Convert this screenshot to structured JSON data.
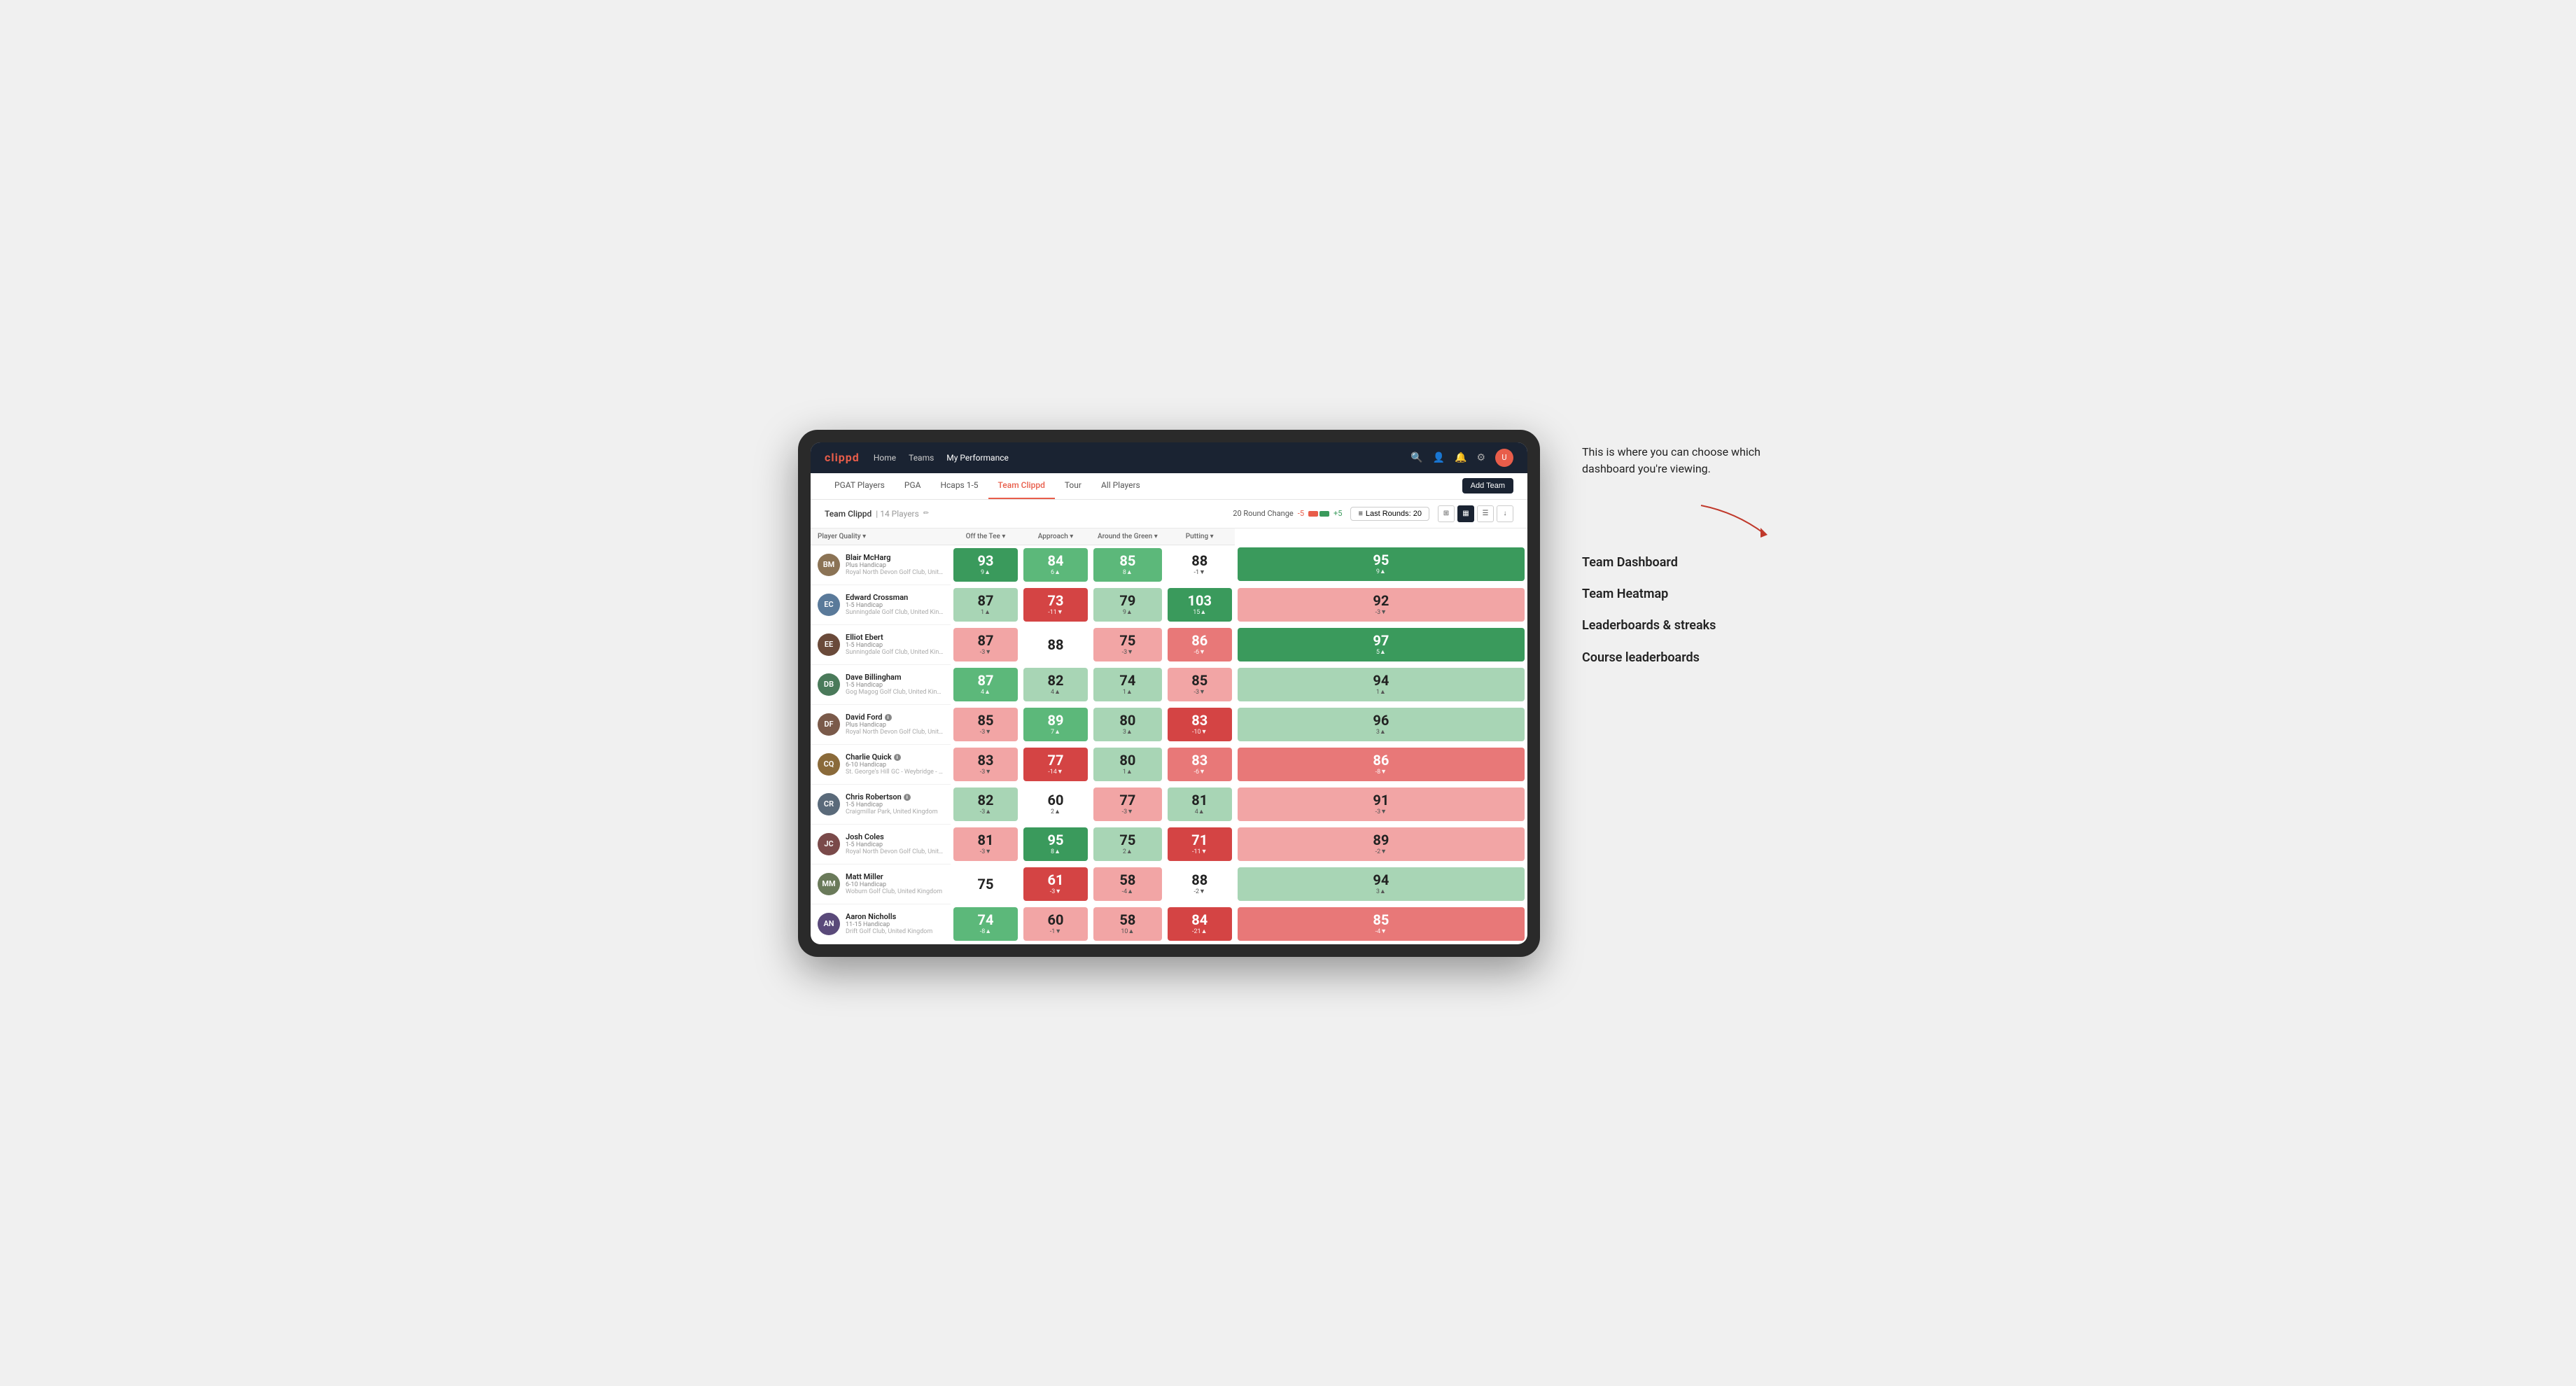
{
  "annotation": {
    "text": "This is where you can choose which dashboard you're viewing.",
    "menu_options": [
      "Team Dashboard",
      "Team Heatmap",
      "Leaderboards & streaks",
      "Course leaderboards"
    ]
  },
  "nav": {
    "logo": "clippd",
    "links": [
      {
        "label": "Home",
        "active": false
      },
      {
        "label": "Teams",
        "active": false
      },
      {
        "label": "My Performance",
        "active": true
      }
    ],
    "icons": [
      "search",
      "user",
      "bell",
      "settings",
      "avatar"
    ]
  },
  "sub_nav": {
    "links": [
      {
        "label": "PGAT Players",
        "active": false
      },
      {
        "label": "PGA",
        "active": false
      },
      {
        "label": "Hcaps 1-5",
        "active": false
      },
      {
        "label": "Team Clippd",
        "active": true
      },
      {
        "label": "Tour",
        "active": false
      },
      {
        "label": "All Players",
        "active": false
      }
    ],
    "add_team_label": "Add Team"
  },
  "team_header": {
    "title": "Team Clippd",
    "player_count": "14 Players",
    "round_change_label": "20 Round Change",
    "round_change_neg": "-5",
    "round_change_pos": "+5",
    "last_rounds_label": "Last Rounds: 20"
  },
  "columns": {
    "player_quality": "Player Quality ▾",
    "off_tee": "Off the Tee ▾",
    "approach": "Approach ▾",
    "around_green": "Around the Green ▾",
    "putting": "Putting ▾"
  },
  "players": [
    {
      "name": "Blair McHarg",
      "handicap": "Plus Handicap",
      "club": "Royal North Devon Golf Club, United Kingdom",
      "initials": "BM",
      "avatar_color": "#8B7355",
      "scores": [
        {
          "value": "93",
          "change": "9▲",
          "bg": "bg-green-dark",
          "light": true
        },
        {
          "value": "84",
          "change": "6▲",
          "bg": "bg-green-mid",
          "light": true
        },
        {
          "value": "85",
          "change": "8▲",
          "bg": "bg-green-mid",
          "light": true
        },
        {
          "value": "88",
          "change": "-1▼",
          "bg": "bg-white",
          "light": false
        },
        {
          "value": "95",
          "change": "9▲",
          "bg": "bg-green-dark",
          "light": true
        }
      ]
    },
    {
      "name": "Edward Crossman",
      "handicap": "1-5 Handicap",
      "club": "Sunningdale Golf Club, United Kingdom",
      "initials": "EC",
      "avatar_color": "#5a7a9a",
      "scores": [
        {
          "value": "87",
          "change": "1▲",
          "bg": "bg-green-light",
          "light": false
        },
        {
          "value": "73",
          "change": "-11▼",
          "bg": "bg-red-dark",
          "light": true
        },
        {
          "value": "79",
          "change": "9▲",
          "bg": "bg-green-light",
          "light": false
        },
        {
          "value": "103",
          "change": "15▲",
          "bg": "bg-green-dark",
          "light": true
        },
        {
          "value": "92",
          "change": "-3▼",
          "bg": "bg-red-light",
          "light": false
        }
      ]
    },
    {
      "name": "Elliot Ebert",
      "handicap": "1-5 Handicap",
      "club": "Sunningdale Golf Club, United Kingdom",
      "initials": "EE",
      "avatar_color": "#6a4a3a",
      "scores": [
        {
          "value": "87",
          "change": "-3▼",
          "bg": "bg-red-light",
          "light": false
        },
        {
          "value": "88",
          "change": "",
          "bg": "bg-white",
          "light": false
        },
        {
          "value": "75",
          "change": "-3▼",
          "bg": "bg-red-light",
          "light": false
        },
        {
          "value": "86",
          "change": "-6▼",
          "bg": "bg-red-mid",
          "light": true
        },
        {
          "value": "97",
          "change": "5▲",
          "bg": "bg-green-dark",
          "light": true
        }
      ]
    },
    {
      "name": "Dave Billingham",
      "handicap": "1-5 Handicap",
      "club": "Gog Magog Golf Club, United Kingdom",
      "initials": "DB",
      "avatar_color": "#4a7a5a",
      "scores": [
        {
          "value": "87",
          "change": "4▲",
          "bg": "bg-green-mid",
          "light": true
        },
        {
          "value": "82",
          "change": "4▲",
          "bg": "bg-green-light",
          "light": false
        },
        {
          "value": "74",
          "change": "1▲",
          "bg": "bg-green-light",
          "light": false
        },
        {
          "value": "85",
          "change": "-3▼",
          "bg": "bg-red-light",
          "light": false
        },
        {
          "value": "94",
          "change": "1▲",
          "bg": "bg-green-light",
          "light": false
        }
      ]
    },
    {
      "name": "David Ford",
      "handicap": "Plus Handicap",
      "club": "Royal North Devon Golf Club, United Kingdom",
      "initials": "DF",
      "avatar_color": "#7a5a4a",
      "has_info": true,
      "scores": [
        {
          "value": "85",
          "change": "-3▼",
          "bg": "bg-red-light",
          "light": false
        },
        {
          "value": "89",
          "change": "7▲",
          "bg": "bg-green-mid",
          "light": true
        },
        {
          "value": "80",
          "change": "3▲",
          "bg": "bg-green-light",
          "light": false
        },
        {
          "value": "83",
          "change": "-10▼",
          "bg": "bg-red-dark",
          "light": true
        },
        {
          "value": "96",
          "change": "3▲",
          "bg": "bg-green-light",
          "light": false
        }
      ]
    },
    {
      "name": "Charlie Quick",
      "handicap": "6-10 Handicap",
      "club": "St. George's Hill GC - Weybridge - Surrey, Uni...",
      "initials": "CQ",
      "avatar_color": "#8a6a3a",
      "has_info": true,
      "scores": [
        {
          "value": "83",
          "change": "-3▼",
          "bg": "bg-red-light",
          "light": false
        },
        {
          "value": "77",
          "change": "-14▼",
          "bg": "bg-red-dark",
          "light": true
        },
        {
          "value": "80",
          "change": "1▲",
          "bg": "bg-green-light",
          "light": false
        },
        {
          "value": "83",
          "change": "-6▼",
          "bg": "bg-red-mid",
          "light": true
        },
        {
          "value": "86",
          "change": "-8▼",
          "bg": "bg-red-mid",
          "light": true
        }
      ]
    },
    {
      "name": "Chris Robertson",
      "handicap": "1-5 Handicap",
      "club": "Craigmillar Park, United Kingdom",
      "initials": "CR",
      "avatar_color": "#5a6a7a",
      "has_info": true,
      "scores": [
        {
          "value": "82",
          "change": "-3▲",
          "bg": "bg-green-light",
          "light": false
        },
        {
          "value": "60",
          "change": "2▲",
          "bg": "bg-white",
          "light": false
        },
        {
          "value": "77",
          "change": "-3▼",
          "bg": "bg-red-light",
          "light": false
        },
        {
          "value": "81",
          "change": "4▲",
          "bg": "bg-green-light",
          "light": false
        },
        {
          "value": "91",
          "change": "-3▼",
          "bg": "bg-red-light",
          "light": false
        }
      ]
    },
    {
      "name": "Josh Coles",
      "handicap": "1-5 Handicap",
      "club": "Royal North Devon Golf Club, United Kingdom",
      "initials": "JC",
      "avatar_color": "#7a4a4a",
      "scores": [
        {
          "value": "81",
          "change": "-3▼",
          "bg": "bg-red-light",
          "light": false
        },
        {
          "value": "95",
          "change": "8▲",
          "bg": "bg-green-dark",
          "light": true
        },
        {
          "value": "75",
          "change": "2▲",
          "bg": "bg-green-light",
          "light": false
        },
        {
          "value": "71",
          "change": "-11▼",
          "bg": "bg-red-dark",
          "light": true
        },
        {
          "value": "89",
          "change": "-2▼",
          "bg": "bg-red-light",
          "light": false
        }
      ]
    },
    {
      "name": "Matt Miller",
      "handicap": "6-10 Handicap",
      "club": "Woburn Golf Club, United Kingdom",
      "initials": "MM",
      "avatar_color": "#6a7a5a",
      "scores": [
        {
          "value": "75",
          "change": "",
          "bg": "bg-white",
          "light": false
        },
        {
          "value": "61",
          "change": "-3▼",
          "bg": "bg-red-dark",
          "light": true
        },
        {
          "value": "58",
          "change": "-4▲",
          "bg": "bg-red-light",
          "light": false
        },
        {
          "value": "88",
          "change": "-2▼",
          "bg": "bg-white",
          "light": false
        },
        {
          "value": "94",
          "change": "3▲",
          "bg": "bg-green-light",
          "light": false
        }
      ]
    },
    {
      "name": "Aaron Nicholls",
      "handicap": "11-15 Handicap",
      "club": "Drift Golf Club, United Kingdom",
      "initials": "AN",
      "avatar_color": "#5a4a7a",
      "scores": [
        {
          "value": "74",
          "change": "-8▲",
          "bg": "bg-green-mid",
          "light": true
        },
        {
          "value": "60",
          "change": "-1▼",
          "bg": "bg-red-light",
          "light": false
        },
        {
          "value": "58",
          "change": "10▲",
          "bg": "bg-red-light",
          "light": false
        },
        {
          "value": "84",
          "change": "-21▲",
          "bg": "bg-red-dark",
          "light": true
        },
        {
          "value": "85",
          "change": "-4▼",
          "bg": "bg-red-mid",
          "light": true
        }
      ]
    }
  ]
}
